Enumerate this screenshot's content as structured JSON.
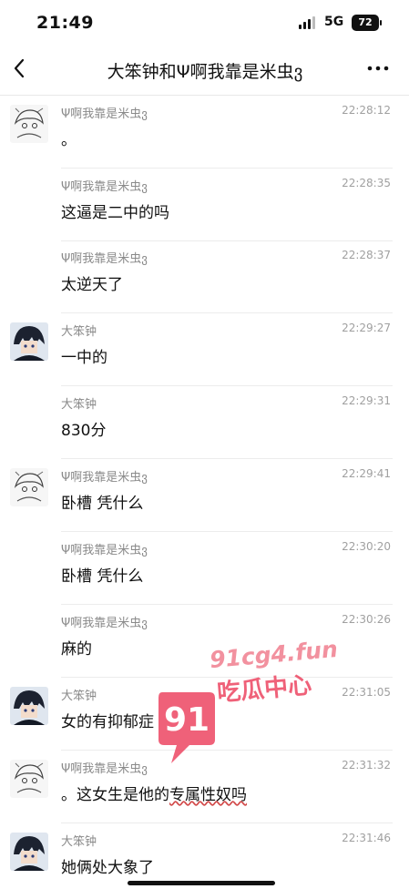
{
  "status_bar": {
    "time": "21:49",
    "network": "5G",
    "battery": "72"
  },
  "nav": {
    "title": "大笨钟和Ψ啊我靠是米虫ვ"
  },
  "messages": [
    {
      "sender": "Ψ啊我靠是米虫ვ",
      "time": "22:28:12",
      "text": "。",
      "avatar": "anime-sketch-avatar"
    },
    {
      "sender": "Ψ啊我靠是米虫ვ",
      "time": "22:28:35",
      "text": "这逼是二中的吗",
      "avatar": ""
    },
    {
      "sender": "Ψ啊我靠是米虫ვ",
      "time": "22:28:37",
      "text": "太逆天了",
      "avatar": ""
    },
    {
      "sender": "大笨钟",
      "time": "22:29:27",
      "text": "一中的",
      "avatar": "anime-dark-hair-avatar"
    },
    {
      "sender": "大笨钟",
      "time": "22:29:31",
      "text": "830分",
      "avatar": ""
    },
    {
      "sender": "Ψ啊我靠是米虫ვ",
      "time": "22:29:41",
      "text": "卧槽 凭什么",
      "avatar": "anime-sketch-avatar"
    },
    {
      "sender": "Ψ啊我靠是米虫ვ",
      "time": "22:30:20",
      "text": "卧槽 凭什么",
      "avatar": ""
    },
    {
      "sender": "Ψ啊我靠是米虫ვ",
      "time": "22:30:26",
      "text": "麻的",
      "avatar": ""
    },
    {
      "sender": "大笨钟",
      "time": "22:31:05",
      "text": "女的有抑郁症",
      "avatar": "anime-dark-hair-avatar"
    },
    {
      "sender": "Ψ啊我靠是米虫ვ",
      "time": "22:31:32",
      "text": "。这女生是他的",
      "text_marked": "专属性奴吗",
      "avatar": "anime-sketch-avatar"
    },
    {
      "sender": "大笨钟",
      "time": "22:31:46",
      "text": "她俩处大象了",
      "avatar": "anime-dark-hair-avatar"
    }
  ],
  "watermark": {
    "url": "91cg4.fun",
    "name": "吃瓜中心",
    "logo_text": "91"
  },
  "colors": {
    "watermark_primary": "#ec3f5c",
    "sender_gray": "#8a8a8a"
  }
}
